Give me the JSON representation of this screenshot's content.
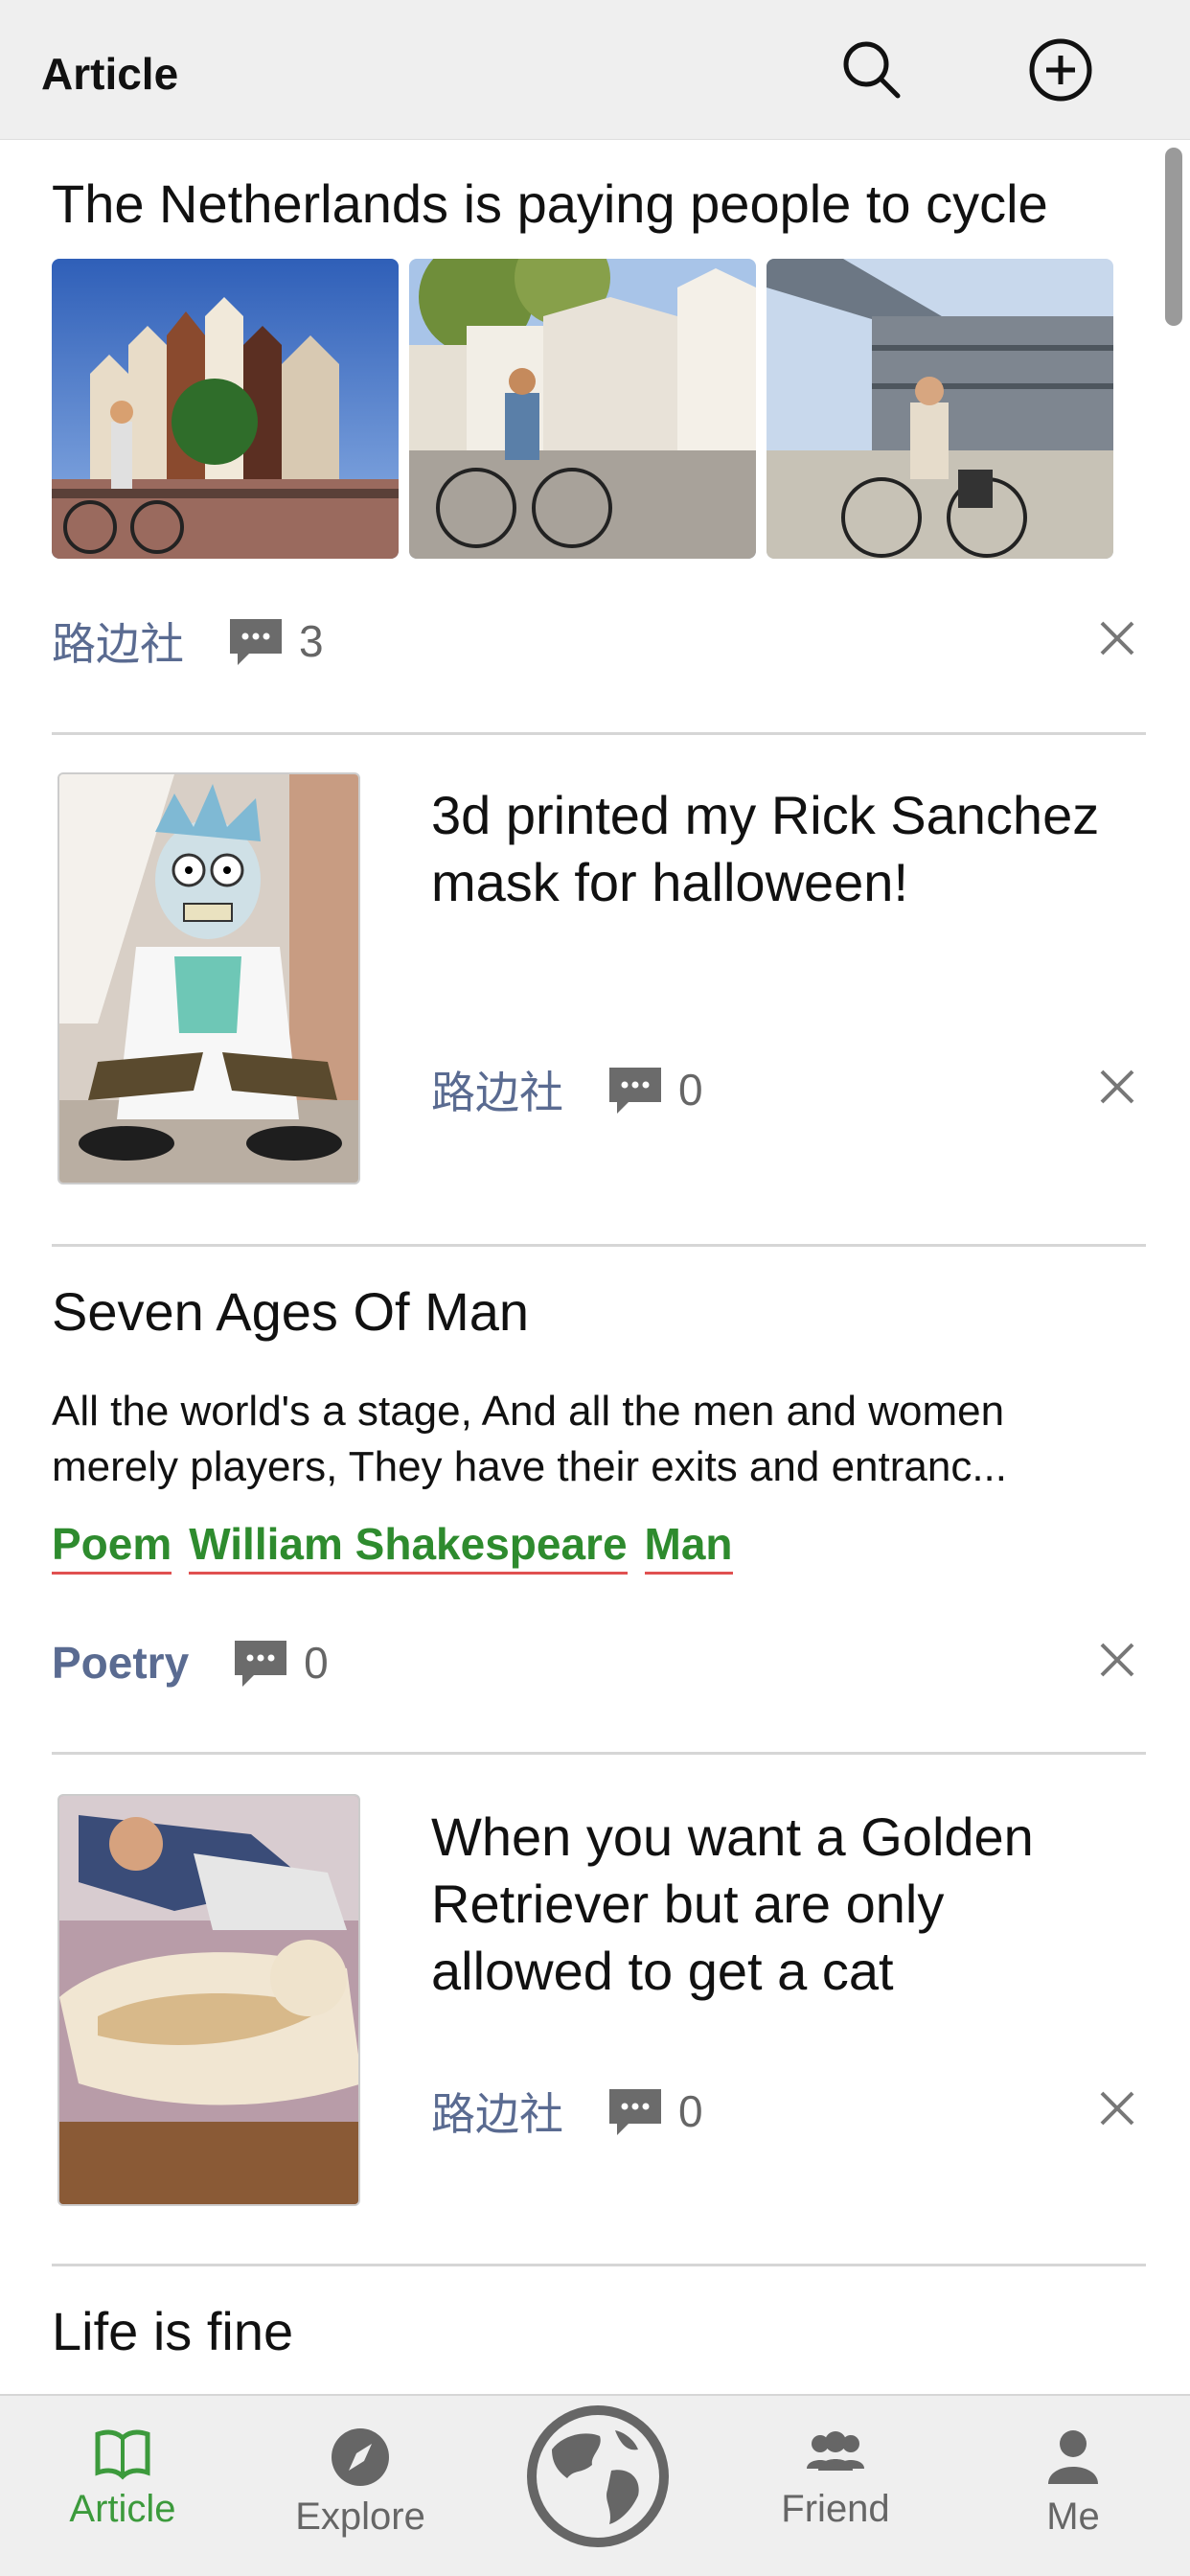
{
  "header": {
    "title": "Article",
    "search_icon": "search-icon",
    "add_icon": "add-circle-icon"
  },
  "posts": [
    {
      "title": "The Netherlands is paying people to cycle",
      "images": [
        "amsterdam-canal-cyclist-photo",
        "cyclist-in-city-square-photo",
        "woman-cycling-by-station-photo"
      ],
      "source": "路边社",
      "comments": "3"
    },
    {
      "title": "3d printed my Rick Sanchez mask for halloween!",
      "image": "person-in-rick-mask-photo",
      "source": "路边社",
      "comments": "0"
    },
    {
      "title": "Seven Ages Of Man",
      "excerpt": "All the world's a stage, And all the men and women\nmerely players, They have their exits and entranc...",
      "tags": [
        "Poem",
        "William Shakespeare",
        "Man"
      ],
      "source": "Poetry",
      "comments": "0"
    },
    {
      "title": "When you want a Golden Retriever but are only allowed to get a cat",
      "image": "fluffy-cat-on-sofa-photo",
      "source": "路边社",
      "comments": "0"
    },
    {
      "title": "Life is fine"
    }
  ],
  "tabs": [
    {
      "label": "Article",
      "icon": "book-icon",
      "active": true
    },
    {
      "label": "Explore",
      "icon": "compass-icon",
      "active": false
    },
    {
      "label": "",
      "icon": "globe-icon",
      "active": false
    },
    {
      "label": "Friend",
      "icon": "people-icon",
      "active": false
    },
    {
      "label": "Me",
      "icon": "person-icon",
      "active": false
    }
  ],
  "colors": {
    "source": "#5a6b91",
    "tag": "#2e8b2e",
    "tag_underline": "#e05050",
    "active_tab": "#3c9a3c",
    "bar_bg": "#efefef"
  }
}
